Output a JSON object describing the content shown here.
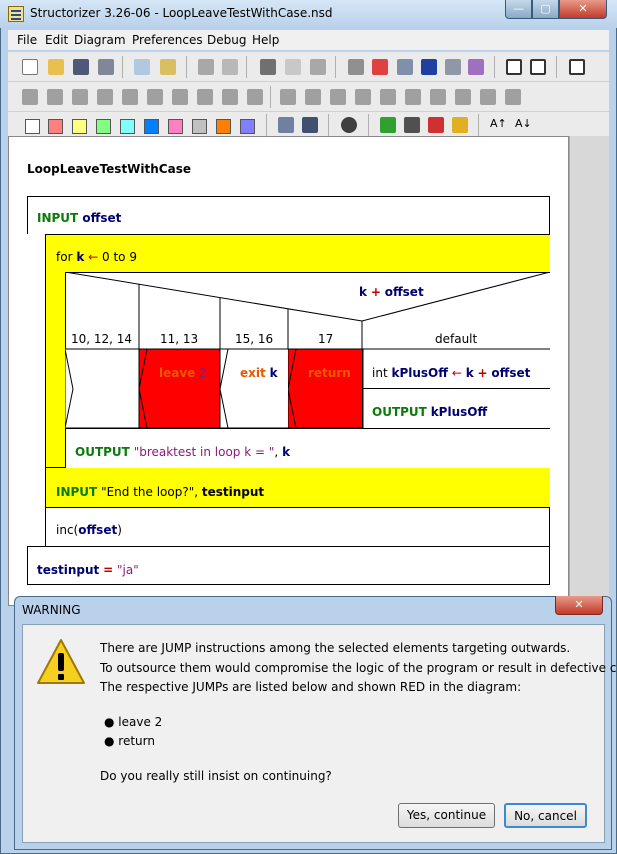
{
  "window": {
    "title": "Structorizer 3.26-06 - LoopLeaveTestWithCase.nsd",
    "buttons": {
      "minimize": "—",
      "maximize": "▢",
      "close": "✕"
    }
  },
  "menu": [
    "File",
    "Edit",
    "Diagram",
    "Preferences",
    "Debug",
    "Help"
  ],
  "palette_colors": [
    "#ffffff",
    "#ff8080",
    "#ffff80",
    "#80ff80",
    "#80ffff",
    "#0080ff",
    "#ff80c0",
    "#c0c0c0",
    "#ff8000",
    "#8080ff"
  ],
  "diagram": {
    "name": "LoopLeaveTestWithCase",
    "input_offset": {
      "kw": "INPUT",
      "var": "offset"
    },
    "for_loop": {
      "kw": "for",
      "var": "k",
      "arrow": "←",
      "range": "0 to 9"
    },
    "case_expr": {
      "var": "k",
      "op": "+",
      "var2": "offset"
    },
    "case_labels": [
      "10, 12, 14",
      "11, 13",
      "15, 16",
      "17",
      "default"
    ],
    "leave": {
      "kw": "leave",
      "num": "2"
    },
    "exit": {
      "kw": "exit",
      "var": "k"
    },
    "return_kw": "return",
    "assign": {
      "type": "int",
      "var": "kPlusOff",
      "arrow": "←",
      "lhs": "k",
      "op": "+",
      "rhs": "offset"
    },
    "output_kplus": {
      "kw": "OUTPUT",
      "var": "kPlusOff"
    },
    "output_break": {
      "kw": "OUTPUT",
      "str": "\"breaktest in loop k = \"",
      "sep": ",",
      "var": "k"
    },
    "input_end": {
      "kw": "INPUT",
      "str": "\"End the loop?\"",
      "sep": ",",
      "var": "testinput"
    },
    "inc": {
      "fn": "inc(",
      "var": "offset",
      "close": ")"
    },
    "testinput_assign": {
      "var": "testinput",
      "op": "=",
      "str": "\"ja\""
    }
  },
  "colors": {
    "loop_yellow": "#ffff00",
    "jump_red": "#ff0000",
    "keyword_green": "#0a7a0a",
    "var_blue": "#000070",
    "string_purple": "#8a1a7a"
  },
  "dialog": {
    "title": "WARNING",
    "close": "✕",
    "lines": [
      "There are JUMP instructions among the selected elements targeting outwards.",
      "To outsource them would compromise the logic of the program or result in defective code!",
      "The respective JUMPs are listed below and shown RED in the diagram:"
    ],
    "bullets": [
      "leave 2",
      "return"
    ],
    "question": "Do you really still insist on continuing?",
    "yes_label": "Yes, continue",
    "no_label": "No, cancel"
  }
}
